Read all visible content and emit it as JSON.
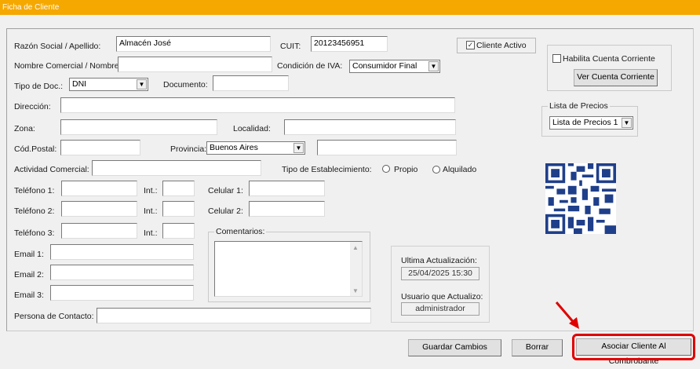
{
  "window": {
    "title": "Ficha de Cliente"
  },
  "labels": {
    "razon_social": "Razón Social / Apellido:",
    "cuit": "CUIT:",
    "nombre_comercial": "Nombre Comercial / Nombres:",
    "condicion_iva": "Condición de IVA:",
    "tipo_doc": "Tipo de Doc.:",
    "documento": "Documento:",
    "direccion": "Dirección:",
    "zona": "Zona:",
    "localidad": "Localidad:",
    "cod_postal": "Cód.Postal:",
    "provincia": "Provincia:",
    "actividad": "Actividad Comercial:",
    "tipo_establecimiento": "Tipo de Establecimiento:",
    "propio": "Propio",
    "alquilado": "Alquilado",
    "telefono1": "Teléfono 1:",
    "telefono2": "Teléfono 2:",
    "telefono3": "Teléfono 3:",
    "int": "Int.:",
    "celular1": "Celular 1:",
    "celular2": "Celular 2:",
    "email1": "Email 1:",
    "email2": "Email 2:",
    "email3": "Email 3:",
    "persona_contacto": "Persona de Contacto:",
    "comentarios": "Comentarios:",
    "cliente_activo": "Cliente Activo",
    "habilita_cc": "Habilita Cuenta Corriente",
    "lista_precios_group": "Lista de Precios",
    "ultima_actualizacion": "Ultima Actualización:",
    "usuario_actualizo": "Usuario que Actualizo:"
  },
  "values": {
    "razon_social": "Almacén José",
    "cuit": "20123456951",
    "condicion_iva": "Consumidor Final",
    "tipo_doc": "DNI",
    "provincia": "Buenos Aires",
    "lista_precios": "Lista de Precios 1",
    "ultima_actualizacion": "25/04/2025 15:30",
    "usuario": "administrador"
  },
  "buttons": {
    "ver_cc": "Ver Cuenta Corriente",
    "guardar": "Guardar Cambios",
    "borrar": "Borrar",
    "asociar": "Asociar Cliente Al Combrobante"
  },
  "colors": {
    "titlebar": "#f5a800",
    "highlight": "#e00000"
  }
}
